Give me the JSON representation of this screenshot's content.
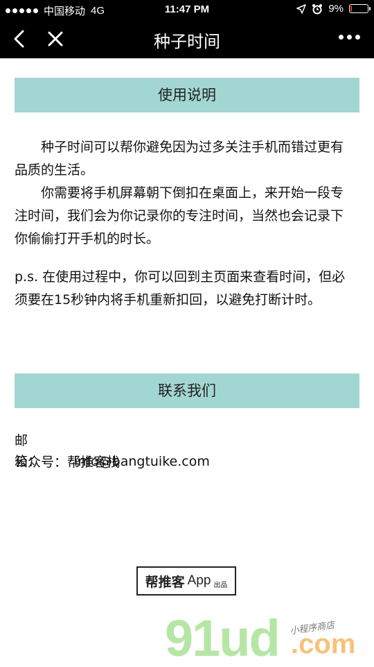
{
  "status_bar": {
    "carrier": "中国移动",
    "network": "4G",
    "time": "11:47 PM",
    "battery": "9%",
    "battery_level": 0.09,
    "battery_color": "#e23b2e"
  },
  "nav": {
    "title": "种子时间",
    "back_icon": "back-chevron-icon",
    "close_icon": "close-icon",
    "more_icon": "more-dots-icon"
  },
  "usage": {
    "header": "使用说明",
    "p1": "种子时间可以帮你避免因为过多关注手机而错过更有品质的生活。",
    "p2": "你需要将手机屏幕朝下倒扣在桌面上，来开始一段专注时间，我们会为你记录你的专注时间，当然也会记录下你偷偷打开手机的时长。",
    "p3": "p.s. 在使用过程中，你可以回到主页面来查看时间，但必须要在15秒钟内将手机重新扣回，以避免打断计时。"
  },
  "contact": {
    "header": "联系我们",
    "email_label": "邮　　箱：",
    "email_value": "info@bangtuike.com",
    "wechat_label": "公众号：",
    "wechat_value": "帮推客栈"
  },
  "footer": {
    "brand_name": "帮推客",
    "brand_app": "App",
    "brand_suffix": "出品"
  },
  "watermark": {
    "main": "91ud",
    "dotcom": ".com",
    "sub": "小程序商店"
  },
  "colors": {
    "section_bar": "#a2d6d2",
    "header_bg": "#000000"
  }
}
